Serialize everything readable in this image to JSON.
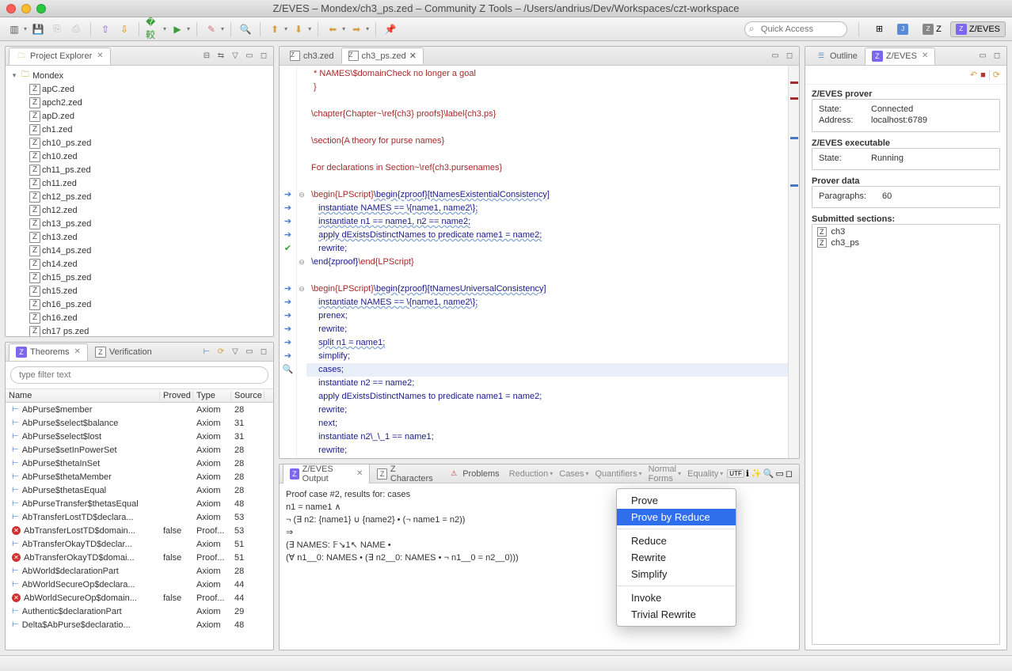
{
  "window": {
    "title": "Z/EVES – Mondex/ch3_ps.zed – Community Z Tools – /Users/andrius/Dev/Workspaces/czt-workspace"
  },
  "quick_access_placeholder": "Quick Access",
  "perspectives": {
    "java": "J",
    "z": "Z",
    "zeves": "Z/EVES"
  },
  "explorer": {
    "title": "Project Explorer",
    "root": "Mondex",
    "files": [
      "apC.zed",
      "apch2.zed",
      "apD.zed",
      "ch1.zed",
      "ch10_ps.zed",
      "ch10.zed",
      "ch11_ps.zed",
      "ch11.zed",
      "ch12_ps.zed",
      "ch12.zed",
      "ch13_ps.zed",
      "ch13.zed",
      "ch14_ps.zed",
      "ch14.zed",
      "ch15_ps.zed",
      "ch15.zed",
      "ch16_ps.zed",
      "ch16.zed",
      "ch17 ps.zed"
    ]
  },
  "theorems": {
    "title": "Theorems",
    "verification_tab": "Verification",
    "filter_placeholder": "type filter text",
    "cols": [
      "Name",
      "Proved",
      "Type",
      "Source"
    ],
    "rows": [
      {
        "ico": "t",
        "name": "AbPurse$member",
        "proved": "",
        "type": "Axiom",
        "src": "28"
      },
      {
        "ico": "t",
        "name": "AbPurse$select$balance",
        "proved": "",
        "type": "Axiom",
        "src": "31"
      },
      {
        "ico": "t",
        "name": "AbPurse$select$lost",
        "proved": "",
        "type": "Axiom",
        "src": "31"
      },
      {
        "ico": "t",
        "name": "AbPurse$setInPowerSet",
        "proved": "",
        "type": "Axiom",
        "src": "28"
      },
      {
        "ico": "t",
        "name": "AbPurse$thetaInSet",
        "proved": "",
        "type": "Axiom",
        "src": "28"
      },
      {
        "ico": "t",
        "name": "AbPurse$thetaMember",
        "proved": "",
        "type": "Axiom",
        "src": "28"
      },
      {
        "ico": "t",
        "name": "AbPurse$thetasEqual",
        "proved": "",
        "type": "Axiom",
        "src": "28"
      },
      {
        "ico": "t",
        "name": "AbPurseTransfer$thetasEqual",
        "proved": "",
        "type": "Axiom",
        "src": "48"
      },
      {
        "ico": "t",
        "name": "AbTransferLostTD$declara...",
        "proved": "",
        "type": "Axiom",
        "src": "53"
      },
      {
        "ico": "x",
        "name": "AbTransferLostTD$domain...",
        "proved": "false",
        "type": "Proof...",
        "src": "53"
      },
      {
        "ico": "t",
        "name": "AbTransferOkayTD$declar...",
        "proved": "",
        "type": "Axiom",
        "src": "51"
      },
      {
        "ico": "x",
        "name": "AbTransferOkayTD$domai...",
        "proved": "false",
        "type": "Proof...",
        "src": "51"
      },
      {
        "ico": "t",
        "name": "AbWorld$declarationPart",
        "proved": "",
        "type": "Axiom",
        "src": "28"
      },
      {
        "ico": "t",
        "name": "AbWorldSecureOp$declara...",
        "proved": "",
        "type": "Axiom",
        "src": "44"
      },
      {
        "ico": "x",
        "name": "AbWorldSecureOp$domain...",
        "proved": "false",
        "type": "Proof...",
        "src": "44"
      },
      {
        "ico": "t",
        "name": "Authentic$declarationPart",
        "proved": "",
        "type": "Axiom",
        "src": "29"
      },
      {
        "ico": "t",
        "name": "Delta$AbPurse$declaratio...",
        "proved": "",
        "type": "Axiom",
        "src": "48"
      }
    ]
  },
  "editor": {
    "tabs": [
      {
        "label": "ch3.zed",
        "active": false
      },
      {
        "label": "ch3_ps.zed",
        "active": true
      }
    ],
    "lines": [
      {
        "g": "",
        "f": "",
        "html": " * NAMES\\$domainCheck no longer a goal",
        "c": "dullred"
      },
      {
        "g": "",
        "f": "",
        "html": " }",
        "c": "dullred"
      },
      {
        "g": "",
        "f": "",
        "html": ""
      },
      {
        "g": "",
        "f": "",
        "html": "\\chapter{Chapter~\\ref{ch3} proofs}\\label{ch3.ps}",
        "c": "dullred"
      },
      {
        "g": "",
        "f": "",
        "html": ""
      },
      {
        "g": "",
        "f": "",
        "html": "\\section{A theory for purse names}",
        "c": "dullred"
      },
      {
        "g": "",
        "f": "",
        "html": ""
      },
      {
        "g": "",
        "f": "",
        "html": "For declarations in Section~\\ref{ch3.pursenames}",
        "c": "dullred"
      },
      {
        "g": "",
        "f": "",
        "html": ""
      },
      {
        "g": "a",
        "f": "-",
        "html": "<span class='dullred'>\\begin{</span><span class='dullred'>LPScript</span><span class='dullred'>}</span><span class='cmd uline'>\\begin{zproof}[tNamesExistentialConsistency]</span>"
      },
      {
        "g": "a",
        "f": "",
        "html": "   <span class='cmd uline'>instantiate NAMES == \\{name1, name2\\};</span>"
      },
      {
        "g": "a",
        "f": "",
        "html": "   <span class='cmd uline'>instantiate n1 == name1, n2 == name2;</span>"
      },
      {
        "g": "a",
        "f": "",
        "html": "   <span class='cmd uline'>apply dExistsDistinctNames to predicate name1 = name2;</span>"
      },
      {
        "g": "c",
        "f": "",
        "html": "   <span class='cmd'>rewrite;</span>"
      },
      {
        "g": "",
        "f": "-",
        "html": "<span class='cmd'>\\end{zproof}</span><span class='dullred'>\\end{LPScript}</span>"
      },
      {
        "g": "",
        "f": "",
        "html": ""
      },
      {
        "g": "a",
        "f": "-",
        "html": "<span class='dullred'>\\begin{LPScript}</span><span class='cmd uline'>\\begin{zproof}[tNamesUniversalConsistency]</span>"
      },
      {
        "g": "a",
        "f": "",
        "html": "   <span class='cmd uline'>instantiate NAMES == \\{name1, name2\\};</span>"
      },
      {
        "g": "a",
        "f": "",
        "html": "   <span class='cmd'>prenex;</span>"
      },
      {
        "g": "a",
        "f": "",
        "html": "   <span class='cmd'>rewrite;</span>"
      },
      {
        "g": "a",
        "f": "",
        "html": "   <span class='cmd uline'>split n1 = name1;</span>"
      },
      {
        "g": "a",
        "f": "",
        "html": "   <span class='cmd'>simplify;</span>"
      },
      {
        "g": "m",
        "f": "",
        "html": "   <span class='cmd'>cases;</span>",
        "hl": true
      },
      {
        "g": "",
        "f": "",
        "html": "   <span class='cmd'>instantiate n2 == name2;</span>"
      },
      {
        "g": "",
        "f": "",
        "html": "   <span class='cmd'>apply dExistsDistinctNames to predicate name1 = name2;</span>"
      },
      {
        "g": "",
        "f": "",
        "html": "   <span class='cmd'>rewrite;</span>"
      },
      {
        "g": "",
        "f": "",
        "html": "   <span class='cmd'>next;</span>"
      },
      {
        "g": "",
        "f": "",
        "html": "   <span class='cmd'>instantiate n2\\_\\_1 == name1;</span>"
      },
      {
        "g": "",
        "f": "",
        "html": "   <span class='cmd'>rewrite;</span>"
      }
    ]
  },
  "output": {
    "tabs": [
      {
        "label": "Z/EVES Output",
        "active": true
      },
      {
        "label": "Z Characters",
        "active": false
      },
      {
        "label": "Problems",
        "active": false
      }
    ],
    "drops": [
      "Reduction",
      "Cases",
      "Quantifiers",
      "Normal Forms",
      "Equality"
    ],
    "utf": "UTF",
    "lines": [
      "Proof case #2, results for: cases",
      "n1 = name1 ∧",
      "   ¬ (∃ n2: {name1} ∪ {name2} • (¬ name1 = n2))",
      "⇒",
      "(∃ NAMES: 𝔽↘1↖ NAME •",
      "   (∀ n1__0: NAMES • (∃ n2__0: NAMES • ¬ n1__0 = n2__0)))"
    ]
  },
  "context_menu": {
    "groups": [
      [
        "Prove",
        "Prove by Reduce"
      ],
      [
        "Reduce",
        "Rewrite",
        "Simplify"
      ],
      [
        "Invoke",
        "Trivial Rewrite"
      ]
    ],
    "selected": "Prove by Reduce"
  },
  "zeves": {
    "outline_tab": "Outline",
    "zeves_tab": "Z/EVES",
    "prover_title": "Z/EVES prover",
    "state_label": "State:",
    "state": "Connected",
    "addr_label": "Address:",
    "addr": "localhost:6789",
    "exec_title": "Z/EVES executable",
    "exec_state": "Running",
    "data_title": "Prover data",
    "para_label": "Paragraphs:",
    "para": "60",
    "sub_title": "Submitted sections:",
    "sections": [
      "ch3",
      "ch3_ps"
    ]
  }
}
